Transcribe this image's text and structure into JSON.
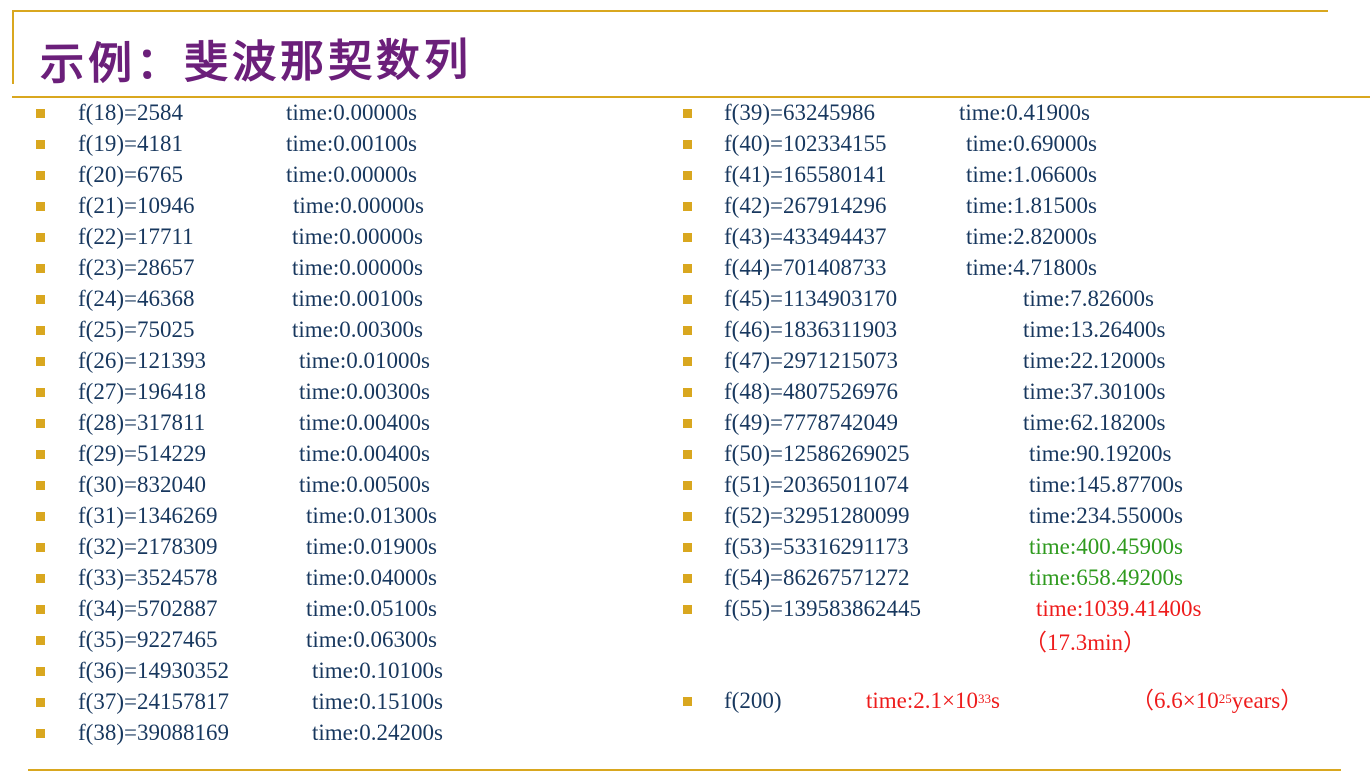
{
  "title": "示例：斐波那契数列",
  "colors": {
    "accent": "#d9a71f",
    "title": "#6b1f7a",
    "text": "#17375e",
    "green": "#2e9a1e",
    "red": "#ee1c1c"
  },
  "left_rows": [
    {
      "f": "f(18)=2584",
      "time": "time:0.00000s"
    },
    {
      "f": "f(19)=4181",
      "time": "time:0.00100s"
    },
    {
      "f": "f(20)=6765",
      "time": "time:0.00000s"
    },
    {
      "f": "f(21)=10946",
      "time": "time:0.00000s"
    },
    {
      "f": "f(22)=17711",
      "time": "time:0.00000s"
    },
    {
      "f": "f(23)=28657",
      "time": "time:0.00000s"
    },
    {
      "f": "f(24)=46368",
      "time": "time:0.00100s"
    },
    {
      "f": "f(25)=75025",
      "time": "time:0.00300s"
    },
    {
      "f": "f(26)=121393",
      "time": "time:0.01000s"
    },
    {
      "f": "f(27)=196418",
      "time": "time:0.00300s"
    },
    {
      "f": "f(28)=317811",
      "time": "time:0.00400s"
    },
    {
      "f": "f(29)=514229",
      "time": "time:0.00400s"
    },
    {
      "f": "f(30)=832040",
      "time": "time:0.00500s"
    },
    {
      "f": "f(31)=1346269",
      "time": "time:0.01300s"
    },
    {
      "f": "f(32)=2178309",
      "time": "time:0.01900s"
    },
    {
      "f": "f(33)=3524578",
      "time": "time:0.04000s"
    },
    {
      "f": "f(34)=5702887",
      "time": "time:0.05100s"
    },
    {
      "f": "f(35)=9227465",
      "time": "time:0.06300s"
    },
    {
      "f": "f(36)=14930352",
      "time": "time:0.10100s"
    },
    {
      "f": "f(37)=24157817",
      "time": "time:0.15100s"
    },
    {
      "f": "f(38)=39088169",
      "time": "time:0.24200s"
    }
  ],
  "right_rows": [
    {
      "f": "f(39)=63245986",
      "time": "time:0.41900s"
    },
    {
      "f": "f(40)=102334155",
      "time": "time:0.69000s"
    },
    {
      "f": "f(41)=165580141",
      "time": "time:1.06600s"
    },
    {
      "f": "f(42)=267914296",
      "time": "time:1.81500s"
    },
    {
      "f": "f(43)=433494437",
      "time": "time:2.82000s"
    },
    {
      "f": "f(44)=701408733",
      "time": "time:4.71800s"
    },
    {
      "f": "f(45)=1134903170",
      "time": "time:7.82600s"
    },
    {
      "f": "f(46)=1836311903",
      "time": "time:13.26400s"
    },
    {
      "f": "f(47)=2971215073",
      "time": "time:22.12000s"
    },
    {
      "f": "f(48)=4807526976",
      "time": "time:37.30100s"
    },
    {
      "f": "f(49)=7778742049",
      "time": "time:62.18200s"
    },
    {
      "f": "f(50)=12586269025",
      "time": "time:90.19200s"
    },
    {
      "f": "f(51)=20365011074",
      "time": "time:145.87700s"
    },
    {
      "f": "f(52)=32951280099",
      "time": "time:234.55000s"
    },
    {
      "f": "f(53)=53316291173",
      "time": "time:400.45900s"
    },
    {
      "f": "f(54)=86267571272",
      "time": "time:658.49200s"
    },
    {
      "f": "f(55)=139583862445",
      "time": "time:1039.41400s"
    }
  ],
  "f55_note": "（17.3min）",
  "f200": {
    "label": "f(200)",
    "time_prefix": "time:2.1×10",
    "time_exp": "33",
    "time_suffix": "s",
    "years_prefix": "（6.6×10",
    "years_exp": "25",
    "years_suffix": "years）"
  }
}
